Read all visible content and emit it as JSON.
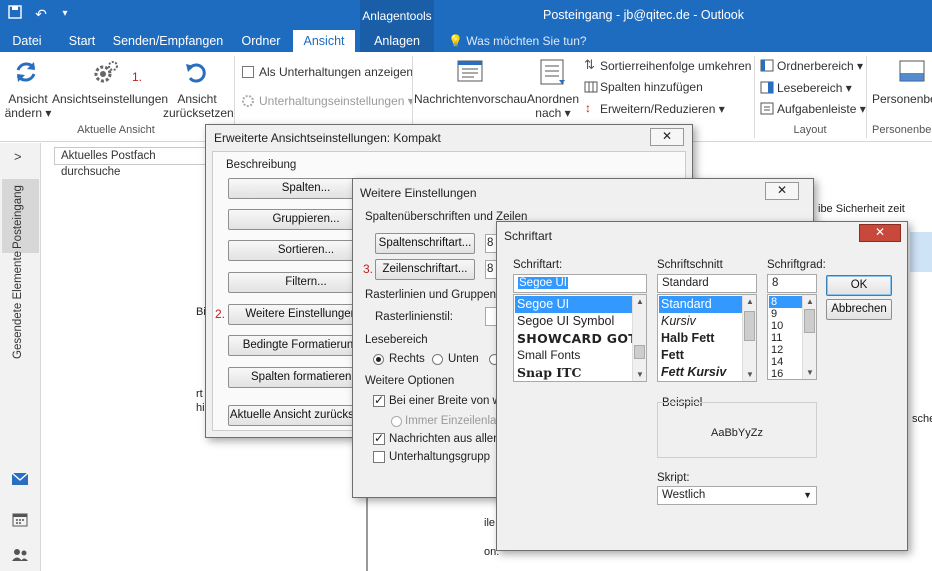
{
  "titlebar": {
    "context_tab": "Anlagentools",
    "title": "Posteingang - jb@qitec.de - Outlook"
  },
  "tabs": [
    {
      "label": "Datei"
    },
    {
      "label": "Start"
    },
    {
      "label": "Senden/Empfangen"
    },
    {
      "label": "Ordner"
    },
    {
      "label": "Ansicht"
    },
    {
      "label": "Anlagen"
    }
  ],
  "tellme": "Was möchten Sie tun?",
  "ribbon": {
    "view_change": "Ansicht\nändern ▾",
    "view_settings": "Ansichtseinstellungen",
    "view_reset": "Ansicht\nzurücksetzen",
    "group_current_view": "Aktuelle Ansicht",
    "show_conversations": "Als Unterhaltungen anzeigen",
    "conversation_settings": "Unterhaltungseinstellungen ▾",
    "message_preview": "Nachrichtenvorschau",
    "arrange_by": "Anordnen\nnach ▾",
    "reverse_sort": "Sortierreihenfolge umkehren",
    "add_columns": "Spalten hinzufügen",
    "expand_collapse": "Erweitern/Reduzieren ▾",
    "folder_pane": "Ordnerbereich ▾",
    "reading_pane": "Lesebereich ▾",
    "todo_bar": "Aufgabenleiste ▾",
    "group_layout": "Layout",
    "people_pane": "Personenbe",
    "group_people_pane": "Personenbe",
    "step1": "1."
  },
  "leftnav": {
    "inbox": "Posteingang",
    "sent": "Gesendete Elemente",
    "expand": ">"
  },
  "search": {
    "scope": "Aktuelles Postfach durchsuche"
  },
  "dialog1": {
    "title": "Erweiterte Ansichtseinstellungen: Kompakt",
    "section": "Beschreibung",
    "buttons": [
      "Spalten...",
      "Gruppieren...",
      "Sortieren...",
      "Filtern...",
      "Weitere Einstellungen...",
      "Bedingte Formatierung...",
      "Spalten formatieren...",
      "Aktuelle Ansicht zurücksetzen"
    ],
    "step2": "2."
  },
  "dialog2": {
    "title": "Weitere Einstellungen",
    "sec_columns": "Spaltenüberschriften und Zeilen",
    "btn_column_font": "Spaltenschriftart...",
    "btn_row_font": "Zeilenschriftart...",
    "column_font_value": "8",
    "row_font_value": "8",
    "step3": "3.",
    "sec_grid": "Rasterlinien und Gruppenü",
    "grid_style": "Rasterlinienstil:",
    "sec_reading": "Lesebereich",
    "radio_right": "Rechts",
    "radio_bottom": "Unten",
    "sec_more": "Weitere Optionen",
    "opt_width": "Bei einer Breite von we",
    "opt_single": "Immer Einzeilenlay",
    "opt_preview": "Nachrichten aus allen",
    "opt_groups": "Unterhaltungsgrupp"
  },
  "dialog3": {
    "title": "Schriftart",
    "label_font": "Schriftart:",
    "label_style": "Schriftschnitt",
    "label_size": "Schriftgrad:",
    "font_value": "Segoe UI",
    "style_value": "Standard",
    "size_value": "8",
    "fonts": [
      "Segoe UI",
      "Segoe UI Symbol",
      "SHOWCARD GOTHIC",
      "Small Fonts",
      "Snap ITC"
    ],
    "styles": [
      "Standard",
      "Kursiv",
      "Halb Fett",
      "Fett",
      "Fett Kursiv"
    ],
    "sizes": [
      "8",
      "9",
      "10",
      "11",
      "12",
      "14",
      "16"
    ],
    "ok": "OK",
    "cancel": "Abbrechen",
    "sample_label": "Beispiel",
    "sample_text": "AaBbYyZz",
    "script_label": "Skript:",
    "script_value": "Westlich"
  },
  "bg_text": {
    "r1": "ibe Sicherheit zeit",
    "r2": "sche",
    "b1": "Bi",
    "b2": "rt",
    "b3": "hi",
    "b4": "ile",
    "b5": "on:"
  },
  "colors": {
    "accent": "#1e6cc0",
    "selection": "#3399ff",
    "annotation": "#c0201e"
  }
}
